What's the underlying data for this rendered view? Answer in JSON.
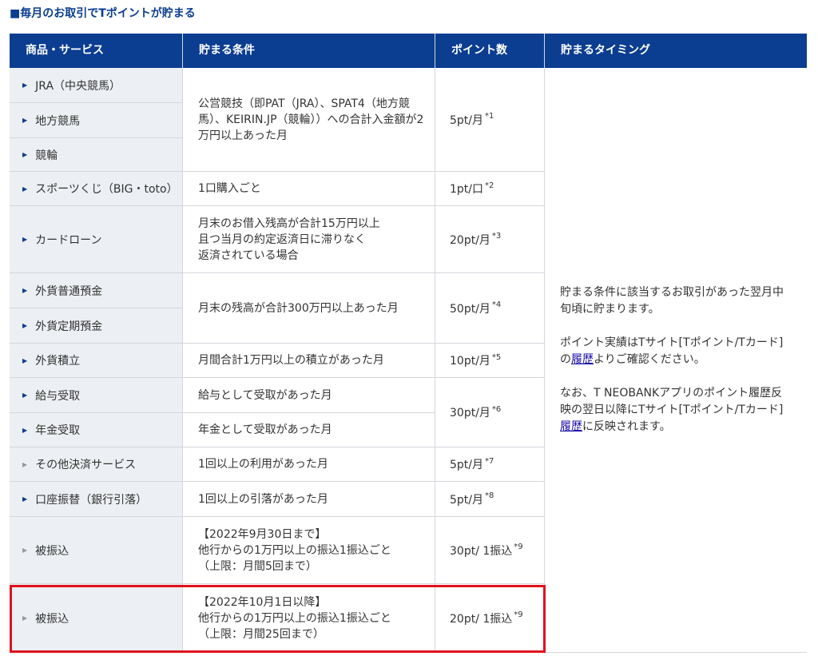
{
  "heading": "■毎月のお取引でTポイントが貯まる",
  "table": {
    "headers": [
      "商品・サービス",
      "貯まる条件",
      "ポイント数",
      "貯まるタイミング"
    ],
    "products": [
      "JRA（中央競馬）",
      "地方競馬",
      "競輪",
      "スポーツくじ（BIG・toto）",
      "カードローン",
      "外貨普通預金",
      "外貨定期預金",
      "外貨積立",
      "給与受取",
      "年金受取",
      "その他決済サービス",
      "口座振替（銀行引落）",
      "被振込",
      "被振込"
    ],
    "conditions": [
      "公営競技（即PAT（JRA）、SPAT4（地方競馬）、KEIRIN.JP（競輪））への合計入金額が2万円以上あった月",
      "1口購入ごと",
      "月末のお借入残高が合計15万円以上\n且つ当月の約定返済日に滞りなく\n返済されている場合",
      "月末の残高が合計300万円以上あった月",
      "月間合計1万円以上の積立があった月",
      "給与として受取があった月",
      "年金として受取があった月",
      "1回以上の利用があった月",
      "1回以上の引落があった月",
      "【2022年9月30日まで】\n他行からの1万円以上の振込1振込ごと\n（上限：月間5回まで）",
      "【2022年10月1日以降】\n他行からの1万円以上の振込1振込ごと\n（上限：月間25回まで）"
    ],
    "points": [
      {
        "value": "5pt/月",
        "note": "*1"
      },
      {
        "value": "1pt/口",
        "note": "*2"
      },
      {
        "value": "20pt/月",
        "note": "*3"
      },
      {
        "value": "50pt/月",
        "note": "*4"
      },
      {
        "value": "10pt/月",
        "note": "*5"
      },
      {
        "value": "30pt/月",
        "note": "*6"
      },
      {
        "value": "5pt/月",
        "note": "*7"
      },
      {
        "value": "5pt/月",
        "note": "*8"
      },
      {
        "value": "30pt/ 1振込",
        "note": "*9"
      },
      {
        "value": "20pt/ 1振込",
        "note": "*9"
      }
    ],
    "timing": {
      "p1": "貯まる条件に該当するお取引があった翌月中旬頃に貯まります。",
      "p2_before": "ポイント実績はTサイト[Tポイント/Tカード]の",
      "p2_link": "履歴",
      "p2_after": "よりご確認ください。",
      "p3_before": "なお、T NEOBANKアプリのポイント履歴反映の翌日以降にTサイト[Tポイント/Tカード]",
      "p3_link": "履歴",
      "p3_after": "に反映されます。"
    }
  },
  "colors": {
    "header_bg": "#0b3d91",
    "highlight": "#e0111e",
    "link": "#1a0dab"
  }
}
